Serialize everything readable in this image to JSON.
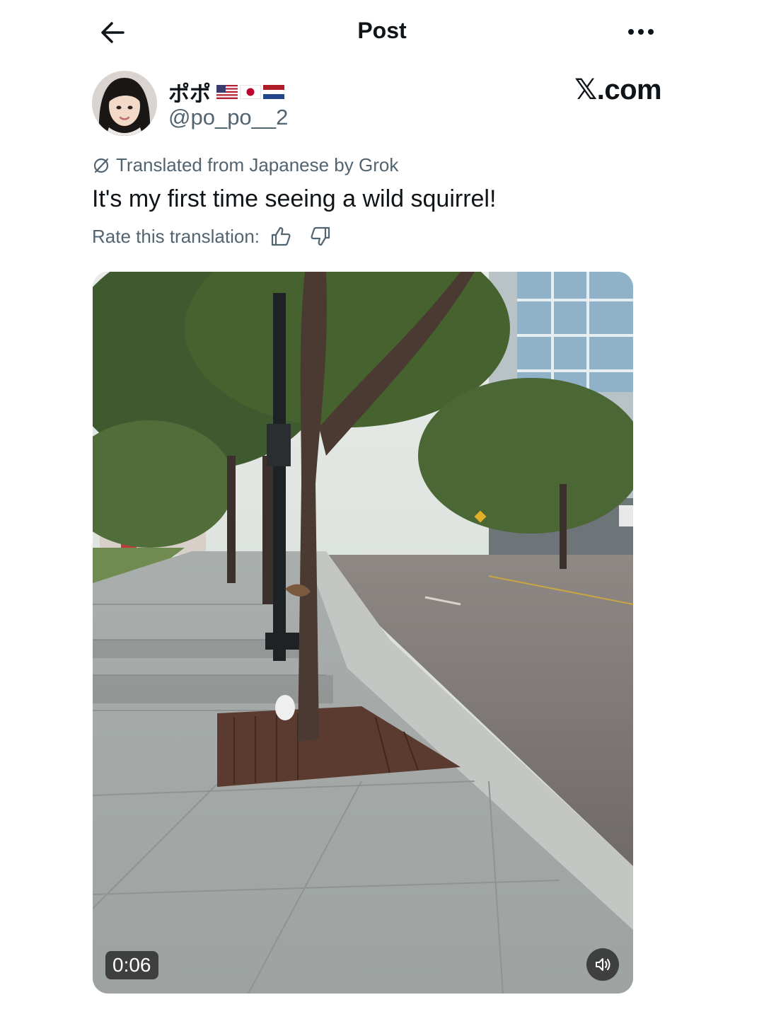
{
  "header": {
    "title": "Post",
    "back_icon": "arrow-left-icon",
    "more_icon": "more-horizontal-icon"
  },
  "author": {
    "display_name": "ポポ",
    "flags": [
      "us-flag",
      "japan-flag",
      "netherlands-flag"
    ],
    "handle": "@po_po__2"
  },
  "brand": "𝕏.com",
  "translation": {
    "note": "Translated from Japanese by Grok",
    "rate_label": "Rate this translation:",
    "icon": "translate-icon"
  },
  "post": {
    "text": "It's my first time seeing a wild squirrel!"
  },
  "video": {
    "elapsed": "0:06",
    "volume_icon": "volume-icon"
  }
}
